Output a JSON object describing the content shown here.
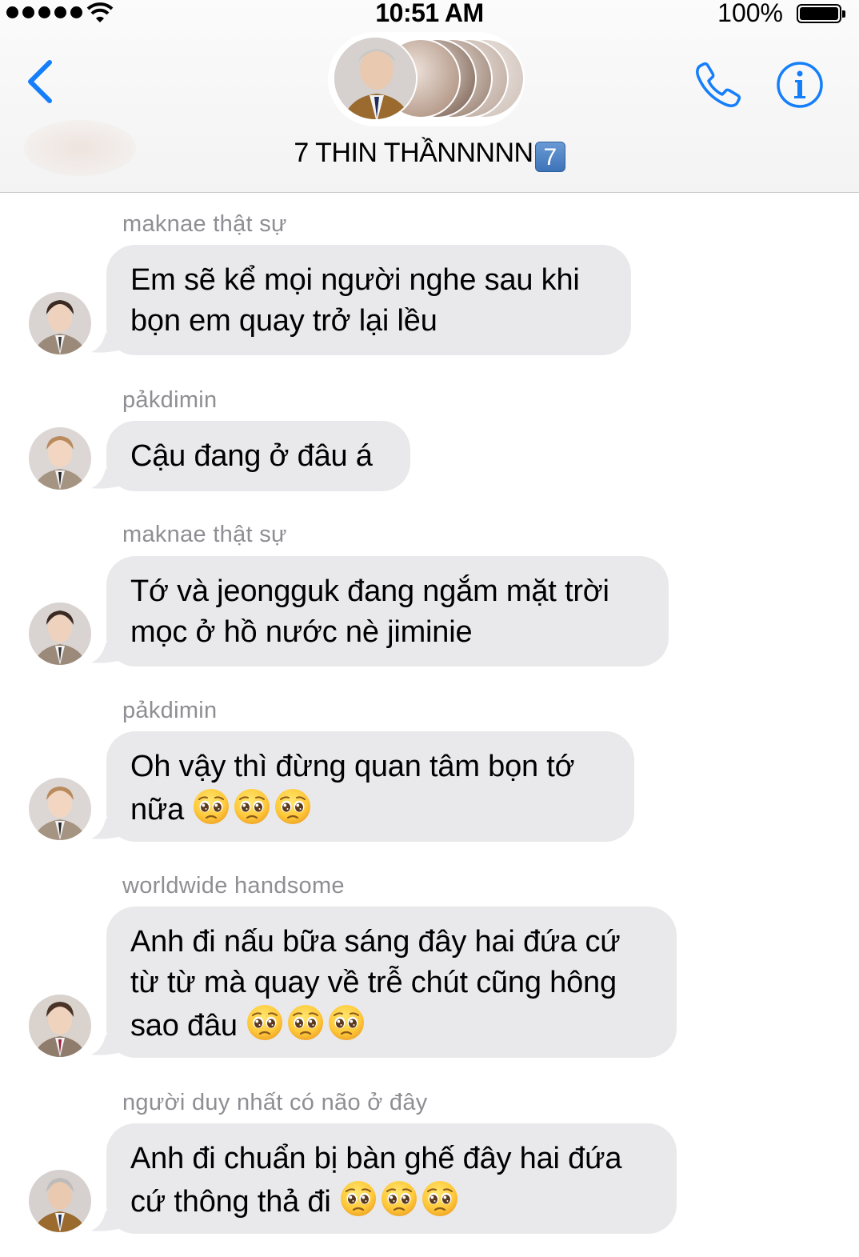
{
  "status_bar": {
    "time": "10:51 AM",
    "battery": "100%"
  },
  "header": {
    "title": "7 THIN THẦNNNNN",
    "badge": "7"
  },
  "messages": [
    {
      "sender": "maknae thật sự",
      "lines": [
        "Em sẽ kể mọi người nghe sau khi",
        "bọn em quay trở lại lều"
      ],
      "emoji_count": 0
    },
    {
      "sender": "pảkdimin",
      "lines": [
        "Cậu đang ở đâu á"
      ],
      "emoji_count": 0
    },
    {
      "sender": "maknae thật sự",
      "lines": [
        "Tớ và jeongguk đang ngắm mặt trời",
        "mọc ở hồ nước nè jiminie"
      ],
      "emoji_count": 0
    },
    {
      "sender": "pảkdimin",
      "lines": [
        "Oh vậy thì đừng quan tâm bọn tớ",
        "nữa"
      ],
      "emoji_count": 3
    },
    {
      "sender": "worldwide handsome",
      "lines": [
        "Anh đi nấu bữa sáng đây hai đứa cứ",
        "từ từ mà quay về trễ chút cũng hông",
        "sao đâu"
      ],
      "emoji_count": 3
    },
    {
      "sender": "người duy nhất có não ở đây",
      "lines": [
        "Anh đi chuẩn bị bàn ghế đây hai đứa",
        "cứ thông thả đi"
      ],
      "emoji_count": 3
    }
  ],
  "icons": {
    "back": "chevron-left-icon",
    "call": "phone-icon",
    "info": "info-icon",
    "emoji": "pleading-face-emoji"
  },
  "colors": {
    "accent": "#157efb",
    "bubble": "#e9e9eb",
    "sender": "#8e8e93"
  }
}
